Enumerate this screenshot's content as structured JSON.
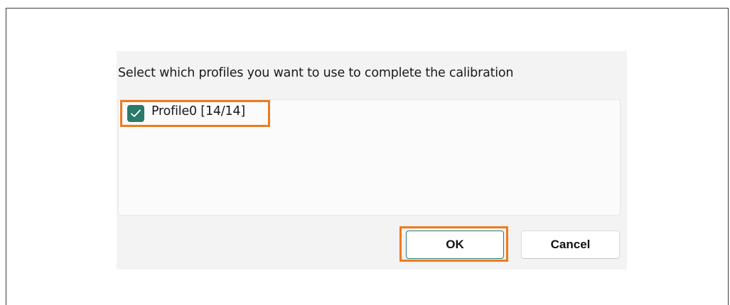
{
  "dialog": {
    "prompt": "Select which profiles you want to use to complete the calibration",
    "profiles": [
      {
        "label": "Profile0 [14/14]",
        "checked": true,
        "icon": "checkmark-icon"
      }
    ],
    "buttons": {
      "ok_label": "OK",
      "cancel_label": "Cancel"
    }
  },
  "colors": {
    "accent": "#2a7a6a",
    "highlight": "#f07a1e",
    "dialog_bg": "#f3f3f3"
  }
}
